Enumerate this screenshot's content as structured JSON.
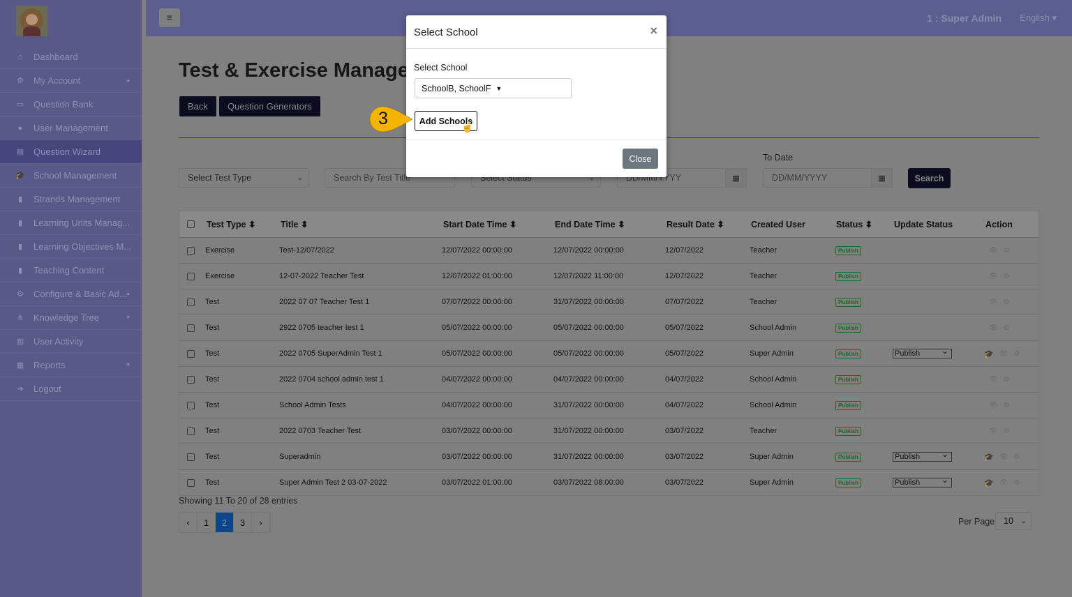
{
  "sidebar": {
    "items": [
      {
        "label": "Dashboard",
        "icon": "home-icon",
        "glyph": "⌂"
      },
      {
        "label": "My Account",
        "icon": "gears-icon",
        "glyph": "⚙",
        "caret": "▲"
      },
      {
        "label": "Question Bank",
        "icon": "laptop-icon",
        "glyph": "▭"
      },
      {
        "label": "User Management",
        "icon": "user-icon",
        "glyph": "●"
      },
      {
        "label": "Question Wizard",
        "icon": "book-icon",
        "glyph": "▤",
        "active": true
      },
      {
        "label": "School Management",
        "icon": "graduation-cap-icon",
        "glyph": "🎓"
      },
      {
        "label": "Strands Management",
        "icon": "file-icon",
        "glyph": "▮"
      },
      {
        "label": "Learning Units Manag...",
        "icon": "file-icon",
        "glyph": "▮"
      },
      {
        "label": "Learning Objectives M...",
        "icon": "file-icon",
        "glyph": "▮"
      },
      {
        "label": "Teaching Content",
        "icon": "file-icon",
        "glyph": "▮"
      },
      {
        "label": "Configure & Basic Ad...",
        "icon": "gears-icon",
        "glyph": "⚙",
        "caret": "▲"
      },
      {
        "label": "Knowledge Tree",
        "icon": "sitemap-icon",
        "glyph": "⋔",
        "caret": "▼"
      },
      {
        "label": "User Activity",
        "icon": "bar-chart-icon",
        "glyph": "▥"
      },
      {
        "label": "Reports",
        "icon": "table-icon",
        "glyph": "▦",
        "caret": "▼"
      },
      {
        "label": "Logout",
        "icon": "sign-out-icon",
        "glyph": "➜"
      }
    ]
  },
  "topbar": {
    "menu_glyph": "≡",
    "user": "1 : Super Admin",
    "language": "English ▾"
  },
  "page": {
    "title": "Test & Exercise Manager",
    "back": "Back",
    "generators": "Question Generators"
  },
  "filters": {
    "test_type": "Select Test Type",
    "search_placeholder": "Search By Test Title",
    "status": "Select Status",
    "from_placeholder": "DD/MM/YYYY",
    "to_label": "To Date",
    "to_placeholder": "DD/MM/YYYY",
    "search": "Search"
  },
  "table": {
    "headers": [
      "Test Type ⬍",
      "Title ⬍",
      "Start Date Time ⬍",
      "End Date Time ⬍",
      "Result Date ⬍",
      "Created User",
      "Status ⬍",
      "Update Status",
      "Action"
    ],
    "rows": [
      {
        "type": "Exercise",
        "title": "Test-12/07/2022",
        "start": "12/07/2022 00:00:00",
        "end": "12/07/2022 00:00:00",
        "result": "12/07/2022",
        "user": "Teacher",
        "status": "Publish",
        "update": ""
      },
      {
        "type": "Exercise",
        "title": "12-07-2022 Teacher Test",
        "start": "12/07/2022 01:00:00",
        "end": "12/07/2022 11:00:00",
        "result": "12/07/2022",
        "user": "Teacher",
        "status": "Publish",
        "update": ""
      },
      {
        "type": "Test",
        "title": "2022 07 07 Teacher Test 1",
        "start": "07/07/2022 00:00:00",
        "end": "31/07/2022 00:00:00",
        "result": "07/07/2022",
        "user": "Teacher",
        "status": "Publish",
        "update": ""
      },
      {
        "type": "Test",
        "title": "2922 0705 teacher test 1",
        "start": "05/07/2022 00:00:00",
        "end": "05/07/2022 00:00:00",
        "result": "05/07/2022",
        "user": "School Admin",
        "status": "Publish",
        "update": ""
      },
      {
        "type": "Test",
        "title": "2022 0705 SuperAdmin Test 1",
        "start": "05/07/2022 00:00:00",
        "end": "05/07/2022 00:00:00",
        "result": "05/07/2022",
        "user": "Super Admin",
        "status": "Publish",
        "update": "Publish"
      },
      {
        "type": "Test",
        "title": "2022 0704 school admin test 1",
        "start": "04/07/2022 00:00:00",
        "end": "04/07/2022 00:00:00",
        "result": "04/07/2022",
        "user": "School Admin",
        "status": "Publish",
        "update": ""
      },
      {
        "type": "Test",
        "title": "School Admin Tests",
        "start": "04/07/2022 00:00:00",
        "end": "31/07/2022 00:00:00",
        "result": "04/07/2022",
        "user": "School Admin",
        "status": "Publish",
        "update": ""
      },
      {
        "type": "Test",
        "title": "2022 0703 Teacher Test",
        "start": "03/07/2022 00:00:00",
        "end": "31/07/2022 00:00:00",
        "result": "03/07/2022",
        "user": "Teacher",
        "status": "Publish",
        "update": ""
      },
      {
        "type": "Test",
        "title": "Superadmin",
        "start": "03/07/2022 00:00:00",
        "end": "31/07/2022 00:00:00",
        "result": "03/07/2022",
        "user": "Super Admin",
        "status": "Publish",
        "update": "Publish"
      },
      {
        "type": "Test",
        "title": "Super Admin Test 2 03-07-2022",
        "start": "03/07/2022 01:00:00",
        "end": "03/07/2022 08:00:00",
        "result": "03/07/2022",
        "user": "Super Admin",
        "status": "Publish",
        "update": "Publish"
      }
    ]
  },
  "pagination": {
    "showing": "Showing 11 To 20 of 28 entries",
    "prev": "‹",
    "pages": [
      "1",
      "2",
      "3"
    ],
    "current": "2",
    "next": "›",
    "per_page_label": "Per Page",
    "per_page": "10"
  },
  "modal": {
    "title": "Select School",
    "close_x": "×",
    "label": "Select School",
    "selected": "SchoolB, SchoolF",
    "add": "Add Schools",
    "close": "Close"
  },
  "callout": {
    "step": "3",
    "color": "#f5b400"
  }
}
